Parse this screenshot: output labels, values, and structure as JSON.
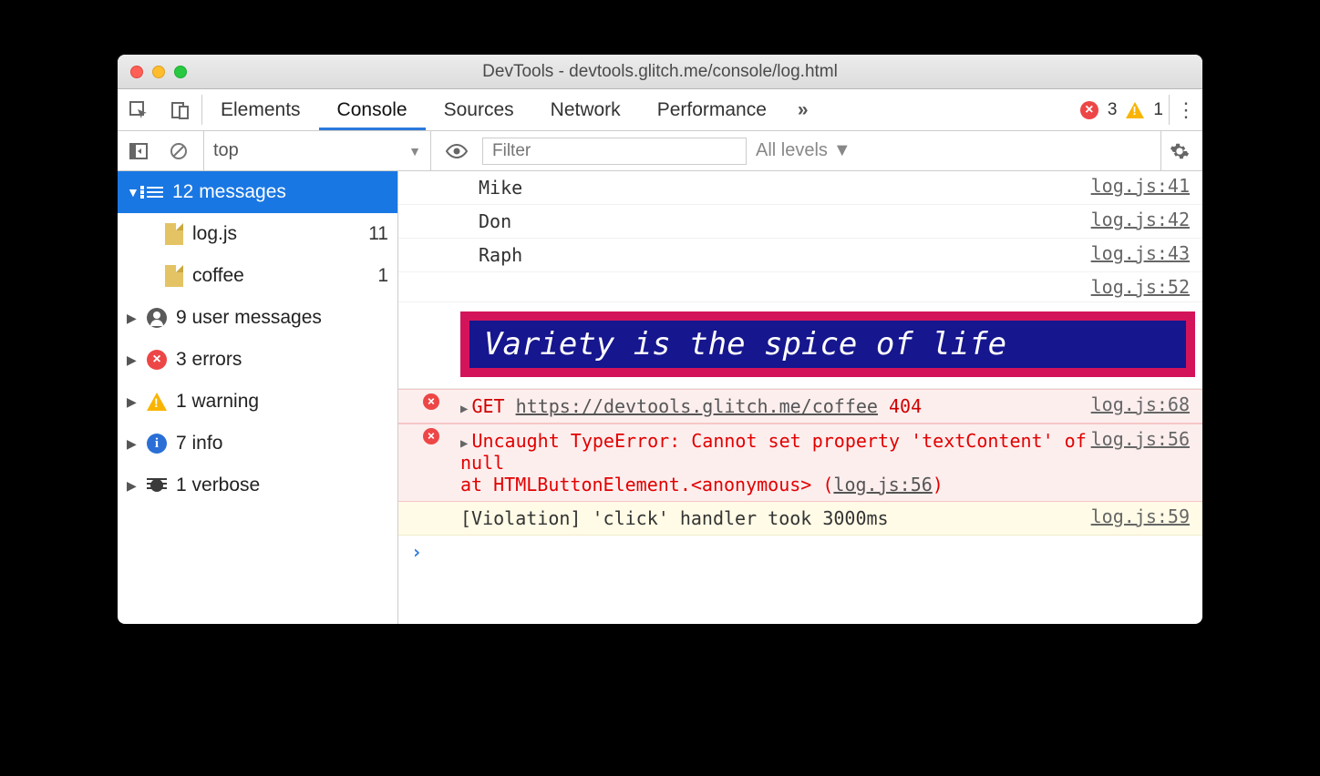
{
  "window_title": "DevTools - devtools.glitch.me/console/log.html",
  "tabs": {
    "elements": "Elements",
    "console": "Console",
    "sources": "Sources",
    "network": "Network",
    "performance": "Performance",
    "more": "»"
  },
  "badges": {
    "errors": "3",
    "warnings": "1"
  },
  "subbar": {
    "context": "top",
    "filter_placeholder": "Filter",
    "levels": "All levels"
  },
  "sidebar": {
    "messages": {
      "label": "12 messages"
    },
    "files": [
      {
        "name": "log.js",
        "count": "11"
      },
      {
        "name": "coffee",
        "count": "1"
      }
    ],
    "user": {
      "label": "9 user messages"
    },
    "errors": {
      "label": "3 errors"
    },
    "warning": {
      "label": "1 warning"
    },
    "info": {
      "label": "7 info"
    },
    "verbose": {
      "label": "1 verbose"
    }
  },
  "console": {
    "rows": [
      {
        "msg": "Mike",
        "src": "log.js:41"
      },
      {
        "msg": "Don",
        "src": "log.js:42"
      },
      {
        "msg": "Raph",
        "src": "log.js:43"
      }
    ],
    "empty_src": "log.js:52",
    "styled": "Variety is the spice of life",
    "err1": {
      "method": "GET",
      "url": "https://devtools.glitch.me/coffee",
      "status": "404",
      "src": "log.js:68"
    },
    "err2": {
      "line1": "Uncaught TypeError: Cannot set property 'textContent' of null",
      "line2a": "    at HTMLButtonElement.<anonymous> (",
      "line2link": "log.js:56",
      "line2b": ")",
      "src": "log.js:56"
    },
    "violation": {
      "msg": "[Violation] 'click' handler took 3000ms",
      "src": "log.js:59"
    }
  }
}
